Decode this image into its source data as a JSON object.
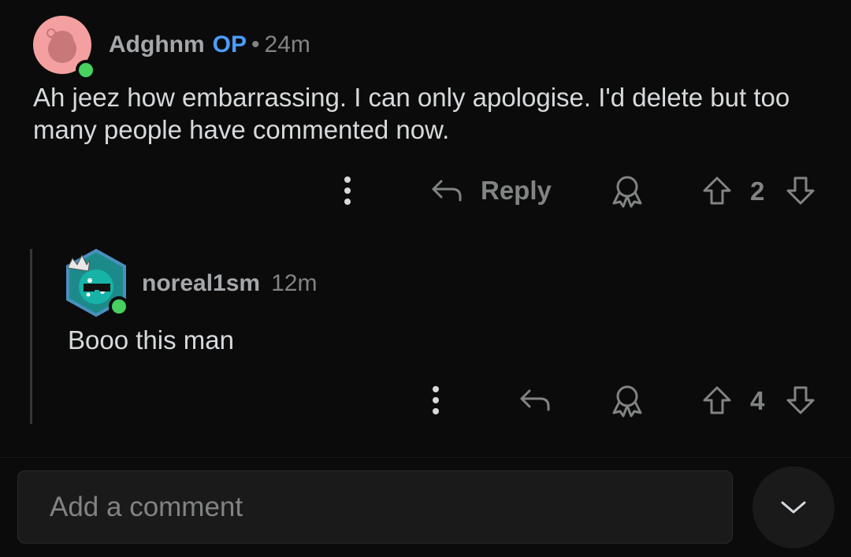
{
  "comments": [
    {
      "author": "Adghnm",
      "op_tag": "OP",
      "separator": "•",
      "time": "24m",
      "body": "Ah jeez how embarrassing. I can only apologise. I'd delete but too many people have commented now.",
      "reply_label": "Reply",
      "votes": "2",
      "online": true
    },
    {
      "author": "noreal1sm",
      "time": "12m",
      "body": "Booo this man",
      "votes": "4",
      "online": true
    }
  ],
  "composer": {
    "placeholder": "Add a comment"
  },
  "colors": {
    "background": "#0b0b0b",
    "op_blue": "#4a9eff",
    "online_green": "#46d160",
    "text": "#d7dadc",
    "muted": "#818384"
  }
}
